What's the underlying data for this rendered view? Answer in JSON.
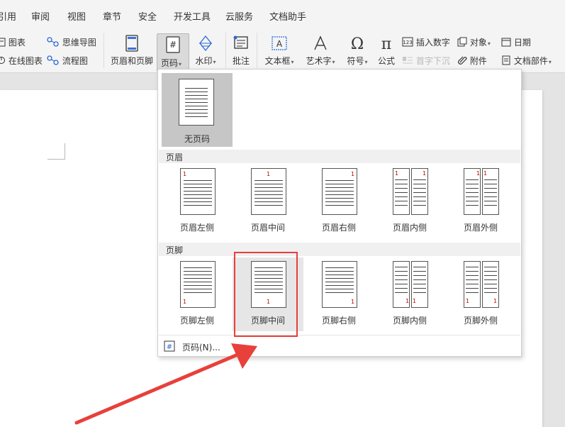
{
  "menu_tabs": [
    "引用",
    "审阅",
    "视图",
    "章节",
    "安全",
    "开发工具",
    "云服务",
    "文档助手"
  ],
  "ribbon": {
    "chart": "图表",
    "mindmap": "思维导图",
    "online_chart": "在线图表",
    "flowchart": "流程图",
    "header_footer": "页眉和页脚",
    "page_number": "页码",
    "watermark": "水印",
    "comment": "批注",
    "textbox": "文本框",
    "wordart": "艺术字",
    "symbol": "符号",
    "formula": "公式",
    "insert_number": "插入数字",
    "drop_cap": "首字下沉",
    "object": "对象",
    "attachment": "附件",
    "date": "日期",
    "doc_parts": "文档部件"
  },
  "dropdown": {
    "no_page_number": "无页码",
    "header_section": "页眉",
    "header_options": [
      "页眉左侧",
      "页眉中间",
      "页眉右侧",
      "页眉内侧",
      "页眉外侧"
    ],
    "footer_section": "页脚",
    "footer_options": [
      "页脚左侧",
      "页脚中间",
      "页脚右侧",
      "页脚内侧",
      "页脚外侧"
    ],
    "page_number_dialog": "页码(N)...",
    "sample_number": "1"
  },
  "colors": {
    "highlight_box": "#e8403a",
    "annotation_arrow": "#e8403a",
    "page_number_digit": "#c00000"
  },
  "icons": [
    "chart-icon",
    "mindmap-icon",
    "online-chart-icon",
    "flowchart-icon",
    "header-footer-icon",
    "page-number-icon",
    "watermark-icon",
    "comment-icon",
    "textbox-icon",
    "wordart-icon",
    "omega-icon",
    "pi-icon",
    "insert-number-icon",
    "drop-cap-icon",
    "object-icon",
    "paperclip-icon",
    "calendar-icon",
    "doc-parts-icon"
  ]
}
